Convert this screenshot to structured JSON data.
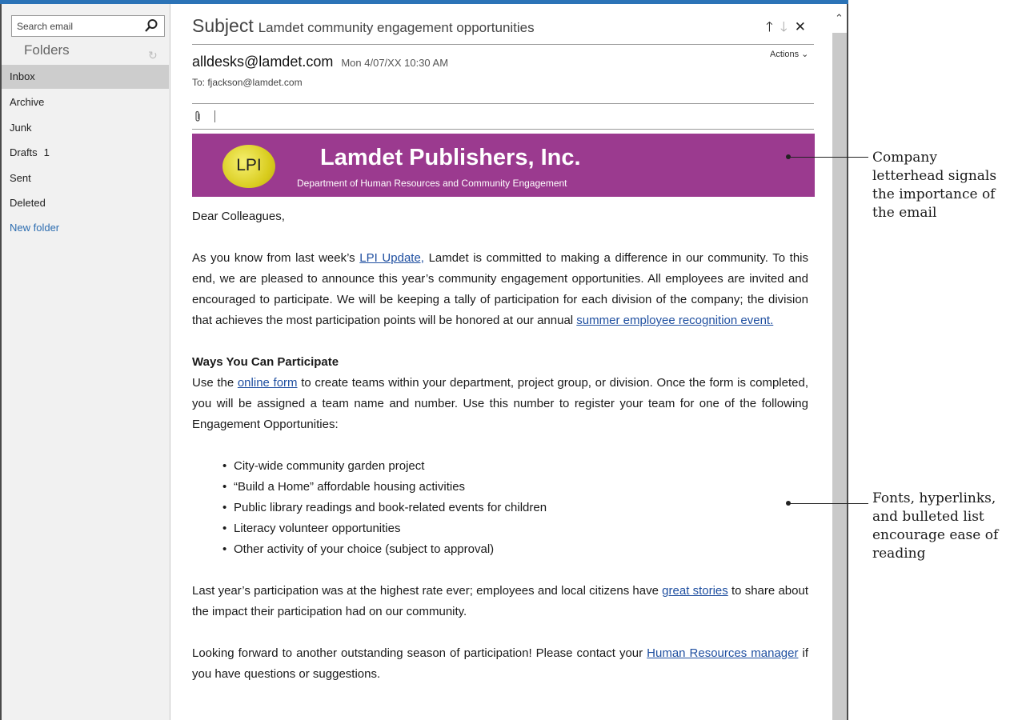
{
  "nav": {
    "search_placeholder": "Search email",
    "folders_header": "Folders",
    "folders": [
      {
        "label": "Inbox",
        "count": ""
      },
      {
        "label": "Archive",
        "count": ""
      },
      {
        "label": "Junk",
        "count": ""
      },
      {
        "label": "Drafts",
        "count": "1"
      },
      {
        "label": "Sent",
        "count": ""
      },
      {
        "label": "Deleted",
        "count": ""
      }
    ],
    "new_folder": "New folder"
  },
  "message": {
    "subject_label": "Subject",
    "subject": "Lamdet community engagement opportunities",
    "from": "alldesks@lamdet.com",
    "date": "Mon 4/07/XX 10:30 AM",
    "actions_label": "Actions",
    "to": "To: fjackson@lamdet.com"
  },
  "letterhead": {
    "logo": "LPI",
    "title": "Lamdet Publishers, Inc.",
    "subtitle": "Department of Human Resources and Community Engagement",
    "color": "#9b3a8f"
  },
  "body": {
    "greeting": "Dear Colleagues,",
    "p1_a": "As you know from last week’s ",
    "p1_link1": "LPI Update,",
    "p1_b": " Lamdet is committed to making a difference in our community. To this end, we are pleased to announce this year’s community engagement opportunities. All employees are invited and encouraged to participate. We will be keeping a tally of participation for each division of the company; the division that achieves the most participation points will be honored at our annual ",
    "p1_link2": "summer employee recognition event.",
    "ways_heading": "Ways You Can Participate",
    "p2_a": "Use the ",
    "p2_link": "online form",
    "p2_b": " to create teams within your department, project group, or division. Once the form is completed, you will be assigned a team name and number. Use this number to register your team for one of the following Engagement Opportunities:",
    "bullets": [
      "City-wide community garden project",
      "“Build a Home” affordable housing activities",
      "Public library readings and book-related events for children",
      "Literacy volunteer opportunities",
      "Other activity of your choice (subject to approval)"
    ],
    "p3_a": "Last year’s participation was at the highest rate ever; employees and local citizens have ",
    "p3_link": "great stories",
    "p3_b": " to share about the impact their participation had on our community.",
    "p4_a": "Looking forward to another outstanding season of participation! Please contact your ",
    "p4_link": "Human Resources manager",
    "p4_b": " if you have questions or suggestions."
  },
  "callouts": {
    "c1": "Company letterhead signals the importance of the email",
    "c2": "Fonts, hyperlinks, and bulleted list encourage ease of reading"
  },
  "colors": {
    "accent": "#2b73b7",
    "link": "#1f4fa0",
    "letterhead": "#9b3a8f"
  }
}
